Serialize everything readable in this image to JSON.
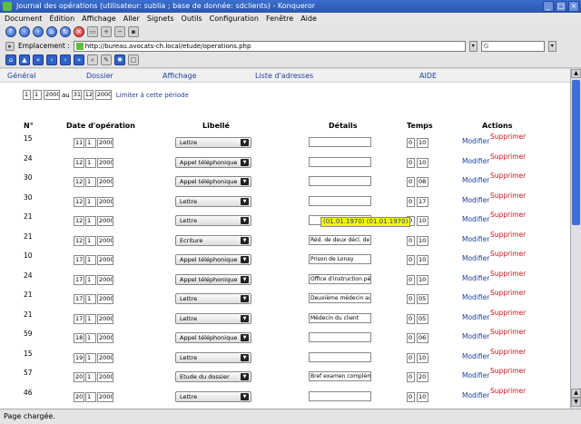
{
  "window": {
    "title": "Journal des opérations (utilisateur: sublia ; base de donnée: sdclients) - Konqueror",
    "buttons": [
      "_",
      "□",
      "×"
    ]
  },
  "menu": [
    "Document",
    "Édition",
    "Affichage",
    "Aller",
    "Signets",
    "Outils",
    "Configuration",
    "Fenêtre",
    "Aide"
  ],
  "location": {
    "label": "Emplacement :",
    "url": "http://bureau.avocats-ch.local/etude/operations.php",
    "search_value": ""
  },
  "tabs": [
    "Général",
    "Dossier",
    "Affichage",
    "Liste d'adresses",
    "AIDE"
  ],
  "period": {
    "start_day": "1",
    "start_month": "1",
    "start_year": "2000",
    "separator": "au",
    "end_day": "31",
    "end_month": "12",
    "end_year": "2000",
    "link": "Limiter à cette période"
  },
  "columns": {
    "num": "N°",
    "date": "Date d'opération",
    "libelle": "Libellé",
    "details": "Détails",
    "temps": "Temps",
    "actions": "Actions"
  },
  "actions": {
    "modify": "Modifier",
    "delete": "Supprimer"
  },
  "rows": [
    {
      "num": "15",
      "day": "11",
      "month": "1",
      "year": "2000",
      "libelle": "Lettre",
      "details": "",
      "h": "0",
      "m": "10"
    },
    {
      "num": "24",
      "day": "12",
      "month": "1",
      "year": "2000",
      "libelle": "Appel téléphonique",
      "details": "",
      "h": "0",
      "m": "10"
    },
    {
      "num": "30",
      "day": "12",
      "month": "1",
      "year": "2000",
      "libelle": "Appel téléphonique",
      "details": "",
      "h": "0",
      "m": "08"
    },
    {
      "num": "30",
      "day": "12",
      "month": "1",
      "year": "2000",
      "libelle": "Lettre",
      "details": "",
      "h": "0",
      "m": "17"
    },
    {
      "num": "21",
      "day": "12",
      "month": "1",
      "year": "2000",
      "libelle": "Lettre",
      "details": "",
      "h": "0",
      "m": "10"
    },
    {
      "num": "21",
      "day": "12",
      "month": "1",
      "year": "2000",
      "libelle": "Ecriture",
      "details": "Réd. de deux décl. de",
      "h": "0",
      "m": "10"
    },
    {
      "num": "10",
      "day": "17",
      "month": "1",
      "year": "2000",
      "libelle": "Appel téléphonique",
      "details": "Prison de Lonay",
      "h": "0",
      "m": "10"
    },
    {
      "num": "24",
      "day": "17",
      "month": "1",
      "year": "2000",
      "libelle": "Appel téléphonique",
      "details": "Office d'instruction pé",
      "h": "0",
      "m": "10"
    },
    {
      "num": "21",
      "day": "17",
      "month": "1",
      "year": "2000",
      "libelle": "Lettre",
      "details": "Deuxième médecin au",
      "h": "0",
      "m": "05"
    },
    {
      "num": "21",
      "day": "17",
      "month": "1",
      "year": "2000",
      "libelle": "Lettre",
      "details": "Médecin du client",
      "h": "0",
      "m": "05"
    },
    {
      "num": "59",
      "day": "18",
      "month": "1",
      "year": "2000",
      "libelle": "Appel téléphonique",
      "details": "",
      "h": "0",
      "m": "06"
    },
    {
      "num": "15",
      "day": "19",
      "month": "1",
      "year": "2000",
      "libelle": "Lettre",
      "details": "",
      "h": "0",
      "m": "10"
    },
    {
      "num": "57",
      "day": "20",
      "month": "1",
      "year": "2000",
      "libelle": "Etude du dossier",
      "details": "Bref examen complème",
      "h": "0",
      "m": "20"
    },
    {
      "num": "46",
      "day": "20",
      "month": "1",
      "year": "2000",
      "libelle": "Lettre",
      "details": "",
      "h": "0",
      "m": "10"
    }
  ],
  "tooltip": "(01.01.1970) (01.01.1970)",
  "status": "Page chargée."
}
